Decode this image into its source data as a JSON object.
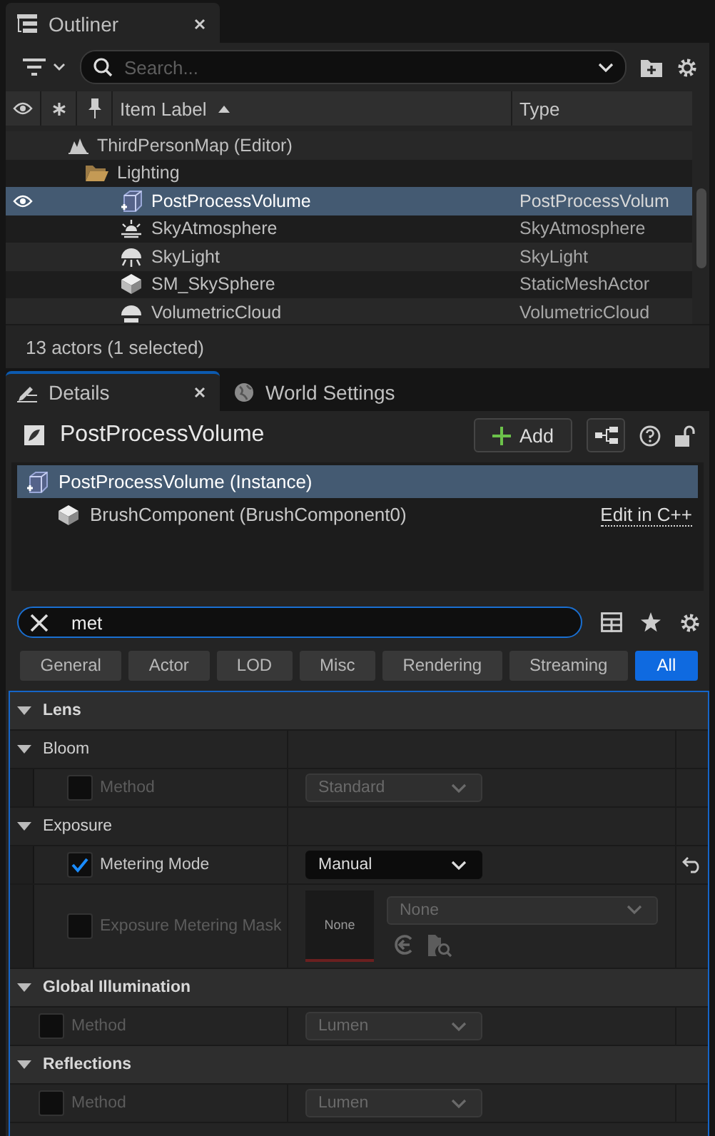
{
  "outliner": {
    "tab": {
      "title": "Outliner"
    },
    "search": {
      "placeholder": "Search..."
    },
    "columns": [
      {
        "label": "Item Label",
        "sorted": true
      },
      {
        "label": "Type",
        "sorted": false
      }
    ],
    "tree": [
      {
        "kind": "map",
        "label": "ThirdPersonMap (Editor)",
        "selected": false,
        "children": [
          {
            "kind": "folder",
            "label": "Lighting",
            "selected": false,
            "children": [
              {
                "kind": "postprocess",
                "label": "PostProcessVolume",
                "type": "PostProcessVolum",
                "selected": true
              },
              {
                "kind": "atmosphere",
                "label": "SkyAtmosphere",
                "type": "SkyAtmosphere",
                "selected": false
              },
              {
                "kind": "skylight",
                "label": "SkyLight",
                "type": "SkyLight",
                "selected": false
              },
              {
                "kind": "mesh",
                "label": "SM_SkySphere",
                "type": "StaticMeshActor",
                "selected": false
              },
              {
                "kind": "cloud",
                "label": "VolumetricCloud",
                "type": "VolumetricCloud",
                "selected": false
              }
            ]
          }
        ]
      }
    ],
    "status": "13 actors (1 selected)"
  },
  "details": {
    "tabs": [
      {
        "kind": "details",
        "label": "Details",
        "selected": true
      },
      {
        "kind": "world",
        "label": "World Settings",
        "selected": false
      }
    ],
    "title": "PostProcessVolume",
    "add_button": "Add",
    "components": [
      {
        "kind": "postprocess",
        "label": "PostProcessVolume (Instance)",
        "selected": true,
        "children": [
          {
            "kind": "brush",
            "label": "BrushComponent (BrushComponent0)",
            "selected": false,
            "link": "Edit in C++"
          }
        ]
      }
    ],
    "search": {
      "value": "met"
    },
    "filters": [
      {
        "label": "General",
        "selected": false
      },
      {
        "label": "Actor",
        "selected": false
      },
      {
        "label": "LOD",
        "selected": false
      },
      {
        "label": "Misc",
        "selected": false
      },
      {
        "label": "Rendering",
        "selected": false
      },
      {
        "label": "Streaming",
        "selected": false
      },
      {
        "label": "All",
        "selected": true
      }
    ],
    "categories": [
      {
        "title": "Lens",
        "expanded": true,
        "subgroups": [
          {
            "title": "Bloom",
            "expanded": true,
            "properties": [
              {
                "kind": "combo",
                "label": "Method",
                "checked": false,
                "value": "Standard",
                "reset": false
              }
            ]
          },
          {
            "title": "Exposure",
            "expanded": true,
            "properties": [
              {
                "kind": "combo",
                "label": "Metering Mode",
                "checked": true,
                "value": "Manual",
                "reset": true
              },
              {
                "kind": "asset",
                "label": "Exposure Metering Mask",
                "checked": false,
                "thumbnail": "None",
                "value": "None",
                "reset": false
              }
            ]
          }
        ]
      },
      {
        "title": "Global Illumination",
        "expanded": true,
        "properties": [
          {
            "kind": "combo",
            "label": "Method",
            "checked": false,
            "value": "Lumen",
            "reset": false
          }
        ]
      },
      {
        "title": "Reflections",
        "expanded": true,
        "properties": [
          {
            "kind": "combo",
            "label": "Method",
            "checked": false,
            "value": "Lumen",
            "reset": false
          }
        ]
      }
    ]
  }
}
